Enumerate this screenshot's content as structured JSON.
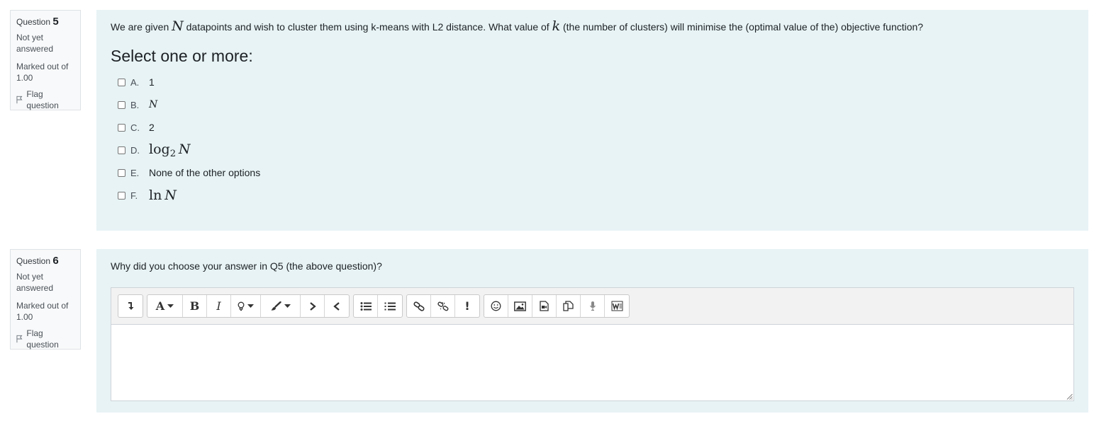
{
  "q5": {
    "info": {
      "label": "Question",
      "number": "5",
      "state": "Not yet answered",
      "grade": "Marked out of 1.00",
      "flag": "Flag question"
    },
    "text": {
      "t1": "We are given ",
      "m1": "N",
      "t2": " datapoints and wish to cluster them using k-means with L2 distance. What value of ",
      "m2": "k",
      "t3": " (the number of clusters) will minimise the (optimal value of the) objective function?"
    },
    "prompt": "Select one or more:",
    "options": [
      {
        "letter": "A.",
        "text": "1"
      },
      {
        "letter": "B.",
        "text": "N"
      },
      {
        "letter": "C.",
        "text": "2"
      },
      {
        "letter": "D.",
        "text_fn": "log",
        "sub": "2",
        "text_var": "N"
      },
      {
        "letter": "E.",
        "text": "None of the other options"
      },
      {
        "letter": "F.",
        "text_fn": "ln",
        "text_var": "N"
      }
    ]
  },
  "q6": {
    "info": {
      "label": "Question",
      "number": "6",
      "state": "Not yet answered",
      "grade": "Marked out of 1.00",
      "flag": "Flag question"
    },
    "text": "Why did you choose your answer in Q5 (the above question)?",
    "toolbar": {
      "font_glyph": "A",
      "bold_glyph": "B",
      "italic_glyph": "I",
      "bang_glyph": "!"
    }
  }
}
